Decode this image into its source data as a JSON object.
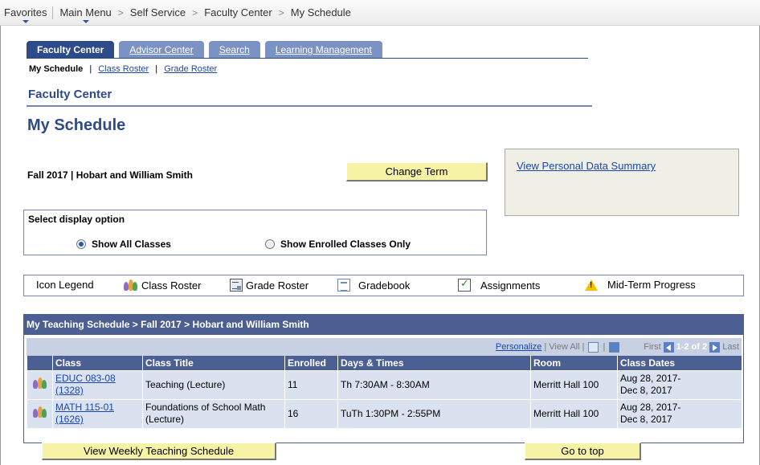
{
  "breadcrumb": {
    "items": [
      "Favorites",
      "Main Menu",
      "Self Service",
      "Faculty Center",
      "My Schedule"
    ],
    "separator": ">"
  },
  "tabs": [
    {
      "label": "Faculty Center",
      "active": true
    },
    {
      "label": "Advisor Center",
      "active": false
    },
    {
      "label": "Search",
      "active": false
    },
    {
      "label": "Learning Management",
      "active": false
    }
  ],
  "subnav": {
    "current": "My Schedule",
    "links": [
      "Class Roster",
      "Grade Roster"
    ],
    "sep": "|"
  },
  "section_title": "Faculty Center",
  "page_title": "My Schedule",
  "term_text": "Fall 2017 | Hobart and William Smith",
  "change_term_label": "Change Term",
  "personal_data_link": "View Personal Data Summary",
  "display_option": {
    "header": "Select display option",
    "options": [
      {
        "label": "Show All Classes",
        "selected": true
      },
      {
        "label": "Show Enrolled Classes Only",
        "selected": false
      }
    ]
  },
  "legend": {
    "title": "Icon Legend",
    "items": [
      {
        "label": "Class Roster",
        "icon": "class-roster-icon"
      },
      {
        "label": "Grade Roster",
        "icon": "grade-roster-icon"
      },
      {
        "label": "Gradebook",
        "icon": "gradebook-icon"
      },
      {
        "label": "Assignments",
        "icon": "assignments-icon"
      },
      {
        "label": "Mid-Term Progress",
        "icon": "warning-icon"
      }
    ]
  },
  "schedule": {
    "title": "My Teaching Schedule > Fall 2017 > Hobart and William Smith",
    "nav": {
      "personalize": "Personalize",
      "view_all": "View All",
      "first": "First",
      "range": "1-2 of 2",
      "last": "Last"
    },
    "columns": [
      "Class",
      "Class Title",
      "Enrolled",
      "Days & Times",
      "Room",
      "Class Dates"
    ],
    "rows": [
      {
        "class_line1": "EDUC 083-08",
        "class_line2": "(1328)",
        "title": "Teaching (Lecture)",
        "enrolled": "11",
        "days_times": "Th 7:30AM - 8:30AM",
        "room": "Merritt Hall 100",
        "dates_line1": "Aug 28, 2017-",
        "dates_line2": "Dec 8, 2017"
      },
      {
        "class_line1": "MATH 115-01",
        "class_line2": "(1626)",
        "title": "Foundations  of School Math (Lecture)",
        "enrolled": "16",
        "days_times": "TuTh 1:30PM - 2:55PM",
        "room": "Merritt Hall 100",
        "dates_line1": "Aug 28, 2017-",
        "dates_line2": "Dec 8, 2017"
      }
    ]
  },
  "weekly_schedule_button": "View Weekly Teaching Schedule",
  "go_to_top_button": "Go to top",
  "colors": {
    "brand_dark": "#2d4a8a",
    "tab_inactive": "#7b93c4",
    "grid_header": "#4c5f93",
    "grid_row": "#dbe2ef",
    "button": "#f7f3a6",
    "link": "#1a46b2"
  }
}
